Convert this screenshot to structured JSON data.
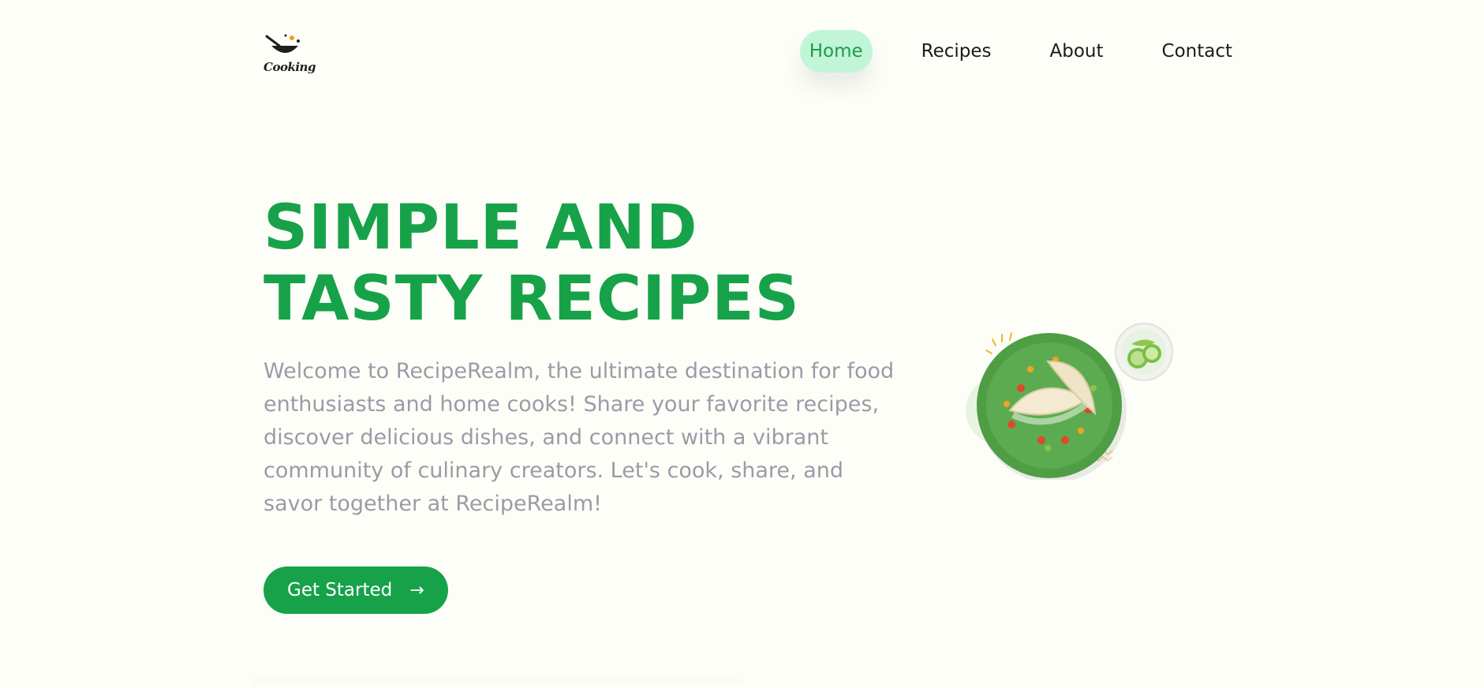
{
  "brand": {
    "logo_text": "Cooking",
    "logo_icon": "cooking-pot-icon"
  },
  "nav": {
    "items": [
      {
        "label": "Home",
        "active": true
      },
      {
        "label": "Recipes",
        "active": false
      },
      {
        "label": "About",
        "active": false
      },
      {
        "label": "Contact",
        "active": false
      }
    ]
  },
  "hero": {
    "title_line1": "SIMPLE AND",
    "title_line2": "TASTY RECIPES",
    "description": "Welcome to RecipeRealm, the ultimate destination for food enthusiasts and home cooks! Share your favorite recipes, discover delicious dishes, and connect with a vibrant community of culinary creators. Let's cook, share, and savor together at RecipeRealm!",
    "cta_label": "Get Started",
    "cta_arrow": "→",
    "image_alt": "tacos-plate-illustration"
  },
  "colors": {
    "accent": "#17a24a",
    "accent_light": "#c1f5d7",
    "background": "#fefef9",
    "muted_text": "#9b9ba6"
  }
}
